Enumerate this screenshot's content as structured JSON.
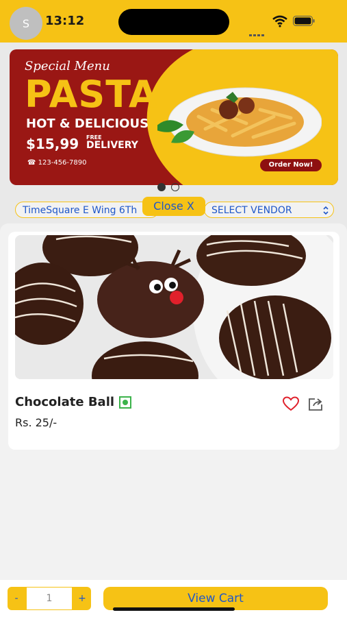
{
  "status_bar": {
    "avatar_letter": "S",
    "time": "13:12"
  },
  "banner": {
    "special": "Special Menu",
    "title": "PASTA",
    "tagline": "HOT & DELICIOUS",
    "price": "$15,99",
    "free": "FREE",
    "delivery": "DELIVERY",
    "phone": "123-456-7890",
    "cta": "Order Now!",
    "carousel_index": 1,
    "carousel_total": 2
  },
  "selectors": {
    "location": "TimeSquare E Wing 6Th",
    "vendor": "SELECT VENDOR"
  },
  "close_label": "Close  X",
  "product": {
    "name": "Chocolate Ball",
    "price": "Rs. 25/-",
    "veg": true
  },
  "cart": {
    "minus": "-",
    "quantity": "1",
    "plus": "+",
    "view_cart": "View Cart"
  },
  "colors": {
    "accent_yellow": "#f6c215",
    "link_blue": "#1f57c9",
    "banner_red": "#9a1714",
    "veg_green": "#3bb34a",
    "heart_red": "#e0202b"
  }
}
